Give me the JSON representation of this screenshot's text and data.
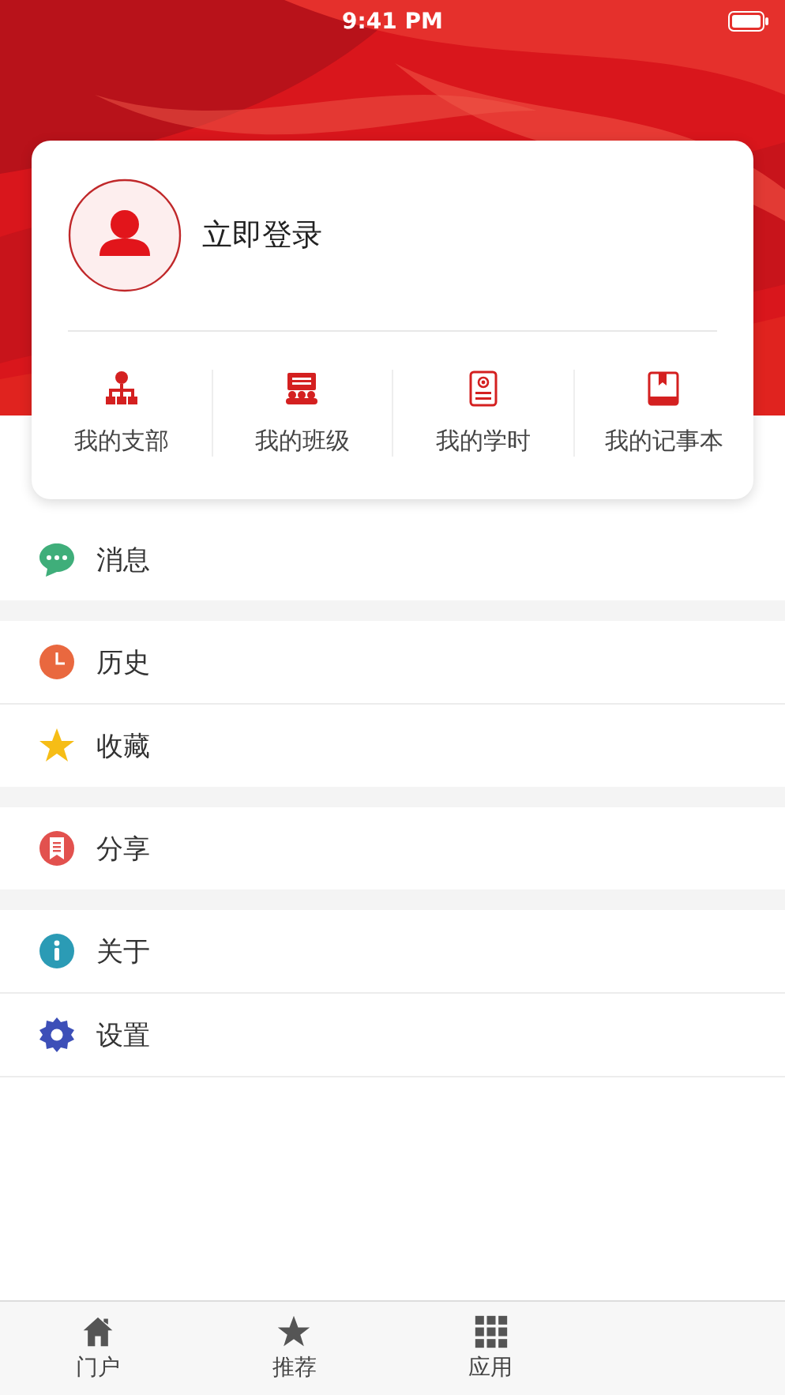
{
  "status_bar": {
    "time": "9:41 PM"
  },
  "profile": {
    "login": "立即登录"
  },
  "shortcuts": [
    {
      "kind": "branch",
      "label": "我的支部"
    },
    {
      "kind": "class",
      "label": "我的班级"
    },
    {
      "kind": "hours",
      "label": "我的学时"
    },
    {
      "kind": "notebook",
      "label": "我的记事本"
    }
  ],
  "menu_groups": [
    [
      {
        "kind": "message",
        "label": "消息"
      }
    ],
    [
      {
        "kind": "history",
        "label": "历史"
      },
      {
        "kind": "favorite",
        "label": "收藏"
      }
    ],
    [
      {
        "kind": "share",
        "label": "分享"
      }
    ],
    [
      {
        "kind": "about",
        "label": "关于"
      },
      {
        "kind": "settings",
        "label": "设置"
      }
    ]
  ],
  "tab_bar": [
    {
      "kind": "home",
      "label": "门户"
    },
    {
      "kind": "star",
      "label": "推荐"
    },
    {
      "kind": "grid",
      "label": "应用"
    }
  ]
}
